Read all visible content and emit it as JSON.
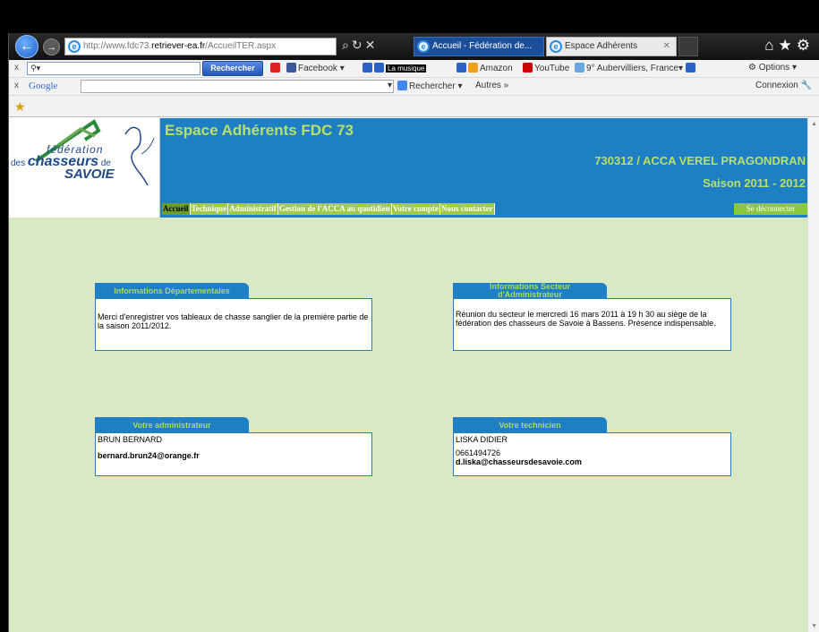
{
  "browser": {
    "address": {
      "prefix": "http://www.fdc73.",
      "host": "retriever-ea.fr",
      "path": "/AccueilTER.aspx"
    },
    "tabs": [
      {
        "label": "Accueil - Fédération de..."
      },
      {
        "label": "Espace Adhérents"
      }
    ]
  },
  "toolbar1": {
    "search_button": "Rechercher",
    "facebook": "Facebook",
    "music": "La musique",
    "amazon": "Amazon",
    "youtube": "YouTube",
    "weather": "9° Aubervilliers, France",
    "options": "Options"
  },
  "toolbar2": {
    "google": "Google",
    "search_button": "Rechercher",
    "more": "Autres",
    "connexion": "Connexion"
  },
  "site": {
    "logo": {
      "line1": "fédération",
      "line2_pre": "des",
      "line2_main": "chasseurs",
      "line2_post": "de",
      "line3": "SAVOIE"
    },
    "title": "Espace Adhérents FDC 73",
    "acca": "730312 / ACCA VEREL PRAGONDRAN",
    "season": "Saison 2011 - 2012",
    "menu": [
      {
        "label": "Accueil"
      },
      {
        "label": "Technique"
      },
      {
        "label": "Administratif"
      },
      {
        "label": "Gestion de l'ACCA au quotidien"
      },
      {
        "label": "Votre compte"
      },
      {
        "label": "Nous contacter"
      }
    ],
    "logout": "Se déconnecter"
  },
  "panels": {
    "dept": {
      "title": "Informations Départementales",
      "text": "Merci d'enregistrer vos tableaux de chasse sanglier de la première partie de la saison 2011/2012."
    },
    "sector": {
      "title_line1": "Informations Secteur",
      "title_line2": "d'Administrateur",
      "text": "Réunion du secteur le mercredi 16 mars 2011 à 19 h 30 au siège de la fédération des chasseurs de Savoie à Bassens. Présence indispensable."
    },
    "admin": {
      "title": "Votre administrateur",
      "name": "BRUN BERNARD",
      "email": "bernard.brun24@orange.fr"
    },
    "tech": {
      "title": "Votre technicien",
      "name": "LISKA DIDIER",
      "phone": "0661494726",
      "email": "d.liska@chasseursdesavoie.com"
    }
  }
}
